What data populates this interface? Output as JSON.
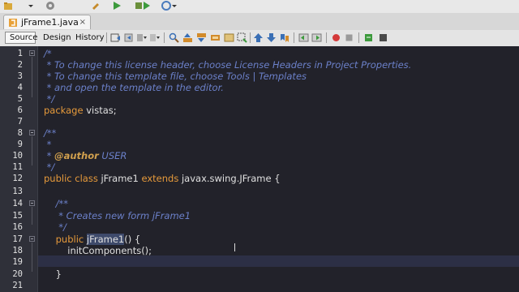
{
  "file_tab": {
    "label": "jFrame1.java",
    "close": "×"
  },
  "editor_tabs": {
    "source": "Source",
    "design": "Design",
    "history": "History"
  },
  "editor": {
    "line_numbers": [
      "1",
      "2",
      "3",
      "4",
      "5",
      "6",
      "7",
      "8",
      "9",
      "10",
      "11",
      "12",
      "13",
      "14",
      "15",
      "16",
      "17",
      "18",
      "19",
      "20",
      "21"
    ],
    "lines": [
      [
        {
          "t": "/*",
          "c": "cmt"
        }
      ],
      [
        {
          "t": " * To change this license header, choose License Headers in Project Properties.",
          "c": "cmt"
        }
      ],
      [
        {
          "t": " * To change this template file, choose Tools | Templates",
          "c": "cmt"
        }
      ],
      [
        {
          "t": " * and open the template in the editor.",
          "c": "cmt"
        }
      ],
      [
        {
          "t": " */",
          "c": "cmt"
        }
      ],
      [
        {
          "t": "package",
          "c": "kw"
        },
        {
          "t": " vistas;",
          "c": "plain"
        }
      ],
      [],
      [
        {
          "t": "/**",
          "c": "cmt"
        }
      ],
      [
        {
          "t": " *",
          "c": "cmt"
        }
      ],
      [
        {
          "t": " * ",
          "c": "cmt"
        },
        {
          "t": "@author",
          "c": "tag"
        },
        {
          "t": " USER",
          "c": "cmt"
        }
      ],
      [
        {
          "t": " */",
          "c": "cmt"
        }
      ],
      [
        {
          "t": "public class",
          "c": "kw"
        },
        {
          "t": " jFrame1 ",
          "c": "plain"
        },
        {
          "t": "extends",
          "c": "kw"
        },
        {
          "t": " javax.swing.JFrame {",
          "c": "plain"
        }
      ],
      [],
      [
        {
          "t": "    /**",
          "c": "cmt"
        }
      ],
      [
        {
          "t": "     * Creates new form jFrame1",
          "c": "cmt"
        }
      ],
      [
        {
          "t": "     */",
          "c": "cmt"
        }
      ],
      [
        {
          "t": "    public",
          "c": "kw"
        },
        {
          "t": " ",
          "c": "plain"
        },
        {
          "t": "jFrame1",
          "c": "hl"
        },
        {
          "t": "() {",
          "c": "plain"
        }
      ],
      [
        {
          "t": "        initComponents();",
          "c": "plain"
        }
      ],
      [],
      [
        {
          "t": "    }",
          "c": "plain"
        }
      ],
      []
    ]
  },
  "colors": {
    "editor_bg": "#22222a",
    "comment": "#6b80c9",
    "keyword": "#e69a3b",
    "current_line": "#2c2f45"
  }
}
